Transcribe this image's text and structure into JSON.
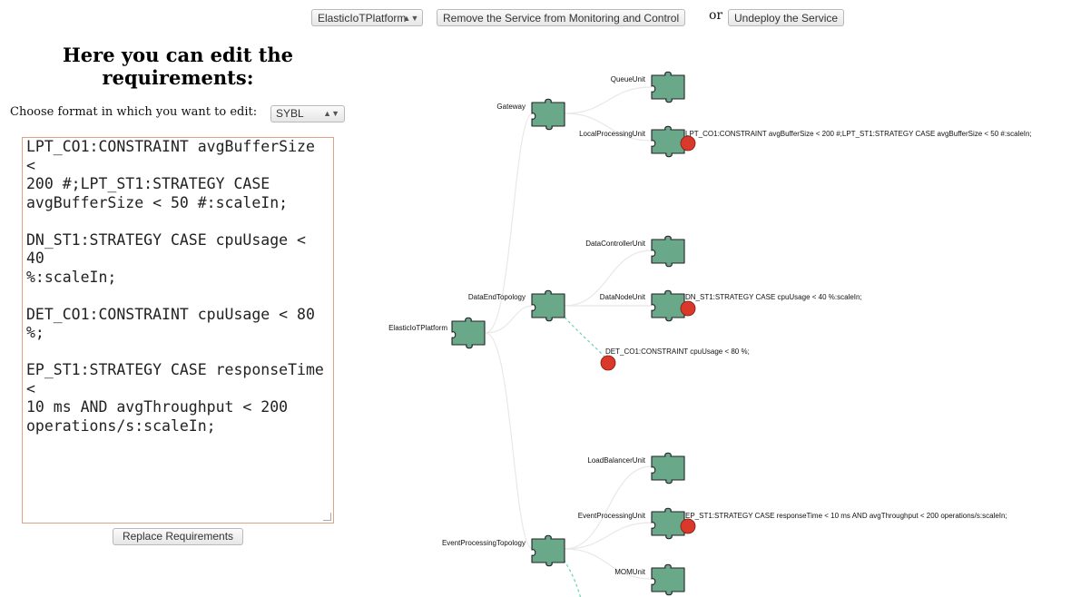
{
  "toolbar": {
    "service_select": "ElasticIoTPlatform",
    "remove_button": "Remove the Service from Monitoring and Control",
    "or_text": "or",
    "undeploy_button": "Undeploy the Service"
  },
  "editor": {
    "heading": "Here you can edit the requirements:",
    "format_label": "Choose format in which you want to edit:",
    "format_value": "SYBL",
    "requirements_text": "LPT_CO1:CONSTRAINT avgBufferSize <\n200 #;LPT_ST1:STRATEGY CASE\navgBufferSize < 50 #:scaleIn;\n\nDN_ST1:STRATEGY CASE cpuUsage < 40\n%:scaleIn;\n\nDET_CO1:CONSTRAINT cpuUsage < 80 %;\n\nEP_ST1:STRATEGY CASE responseTime <\n10 ms AND avgThroughput < 200\noperations/s:scaleIn;",
    "replace_button": "Replace Requirements"
  },
  "topology": {
    "root": "ElasticIoTPlatform",
    "topologies": [
      "Gateway",
      "DataEndTopology",
      "EventProcessingTopology"
    ],
    "units": [
      "QueueUnit",
      "LocalProcessingUnit",
      "DataControllerUnit",
      "DataNodeUnit",
      "LoadBalancerUnit",
      "EventProcessingUnit",
      "MOMUnit"
    ],
    "requirements": {
      "local_processing": "LPT_CO1:CONSTRAINT avgBufferSize < 200 #;LPT_ST1:STRATEGY CASE avgBufferSize < 50 #:scaleIn;",
      "data_node": "DN_ST1:STRATEGY CASE cpuUsage < 40 %:scaleIn;",
      "data_end": "DET_CO1:CONSTRAINT cpuUsage < 80 %;",
      "event_processing": "EP_ST1:STRATEGY CASE responseTime < 10 ms AND avgThroughput < 200 operations/s:scaleIn;"
    }
  },
  "colors": {
    "puzzle_fill": "#6aa88a",
    "requirement_dot": "#d9382b",
    "link": "#e8e8e8",
    "dashed_link": "#66d3b0"
  }
}
